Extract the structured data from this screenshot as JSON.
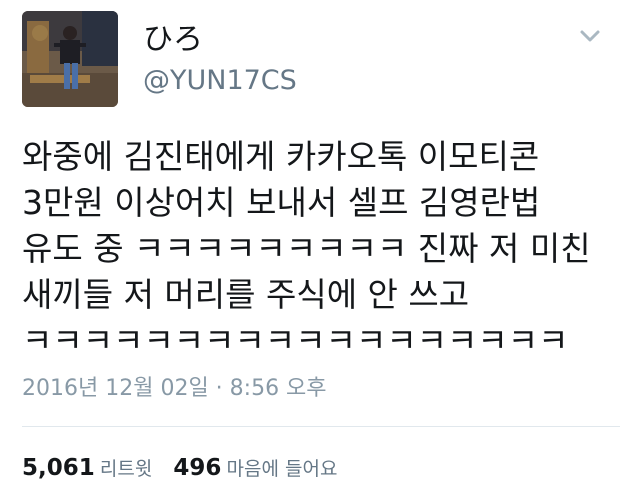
{
  "author": {
    "display_name": "ひろ",
    "handle": "@YUN17CS"
  },
  "tweet": {
    "lines": [
      "와중에 김진태에게 카카오톡 이모티콘",
      "3만원 이상어치 보내서 셀프 김영란법",
      "유도 중 ㅋㅋㅋㅋㅋㅋㅋㅋㅋ 진짜 저 미친",
      "새끼들 저 머리를 주식에 안 쓰고",
      "ㅋㅋㅋㅋㅋㅋㅋㅋㅋㅋㅋㅋㅋㅋㅋㅋㅋㅋ"
    ],
    "timestamp": "2016년 12월 02일 · 8:56 오후"
  },
  "stats": {
    "retweets_count": "5,061",
    "retweets_label": "리트윗",
    "likes_count": "496",
    "likes_label": "마음에 들어요"
  },
  "icons": {
    "menu": "chevron-down-icon"
  },
  "colors": {
    "text": "#14171a",
    "secondary": "#657786",
    "timestamp": "#8899a6",
    "divider": "#e1e8ed"
  }
}
